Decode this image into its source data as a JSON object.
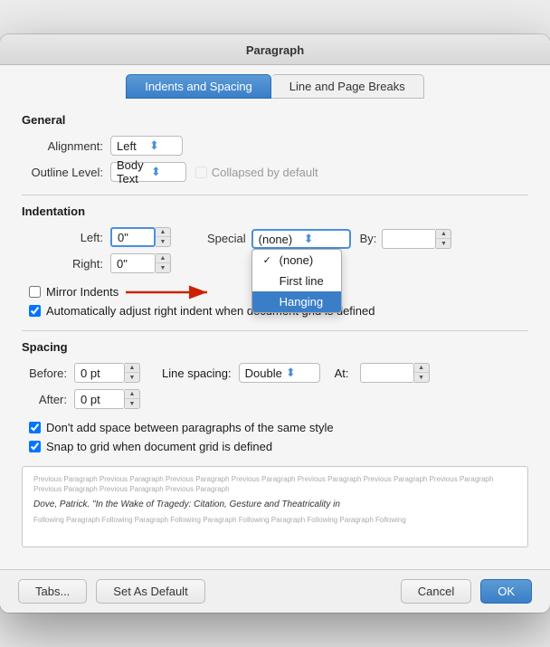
{
  "dialog": {
    "title": "Paragraph"
  },
  "tabs": [
    {
      "id": "indents-spacing",
      "label": "Indents and Spacing",
      "active": true
    },
    {
      "id": "line-page-breaks",
      "label": "Line and Page Breaks",
      "active": false
    }
  ],
  "general": {
    "section_label": "General",
    "alignment_label": "Alignment:",
    "alignment_value": "Left",
    "outline_level_label": "Outline Level:",
    "outline_level_value": "Body Text",
    "collapsed_label": "Collapsed by default"
  },
  "indentation": {
    "section_label": "Indentation",
    "left_label": "Left:",
    "left_value": "0\"",
    "right_label": "Right:",
    "right_value": "0\"",
    "special_label": "Special",
    "special_options": [
      {
        "label": "(none)",
        "selected": true,
        "highlighted": false
      },
      {
        "label": "First line",
        "selected": false,
        "highlighted": false
      },
      {
        "label": "Hanging",
        "selected": false,
        "highlighted": true
      }
    ],
    "by_label": "By:",
    "mirror_label": "Mirror Indents",
    "auto_adjust_label": "Automatically adjust right indent when document grid is defined"
  },
  "spacing": {
    "section_label": "Spacing",
    "before_label": "Before:",
    "before_value": "0 pt",
    "after_label": "After:",
    "after_value": "0 pt",
    "line_spacing_label": "Line spacing:",
    "line_spacing_value": "Double",
    "at_label": "At:",
    "at_value": "",
    "no_space_label": "Don't add space between paragraphs of the same style",
    "snap_grid_label": "Snap to grid when document grid is defined"
  },
  "preview": {
    "prev_text": "Previous Paragraph Previous Paragraph Previous Paragraph Previous Paragraph Previous Paragraph Previous Paragraph Previous Paragraph Previous Paragraph Previous Paragraph Previous Paragraph",
    "main_text": "Dove, Patrick. \"In the Wake of Tragedy: Citation, Gesture and Theatricality in",
    "follow_text": "Following Paragraph Following Paragraph Following Paragraph Following Paragraph Following Paragraph Following"
  },
  "footer": {
    "tabs_label": "Tabs...",
    "default_label": "Set As Default",
    "cancel_label": "Cancel",
    "ok_label": "OK"
  }
}
